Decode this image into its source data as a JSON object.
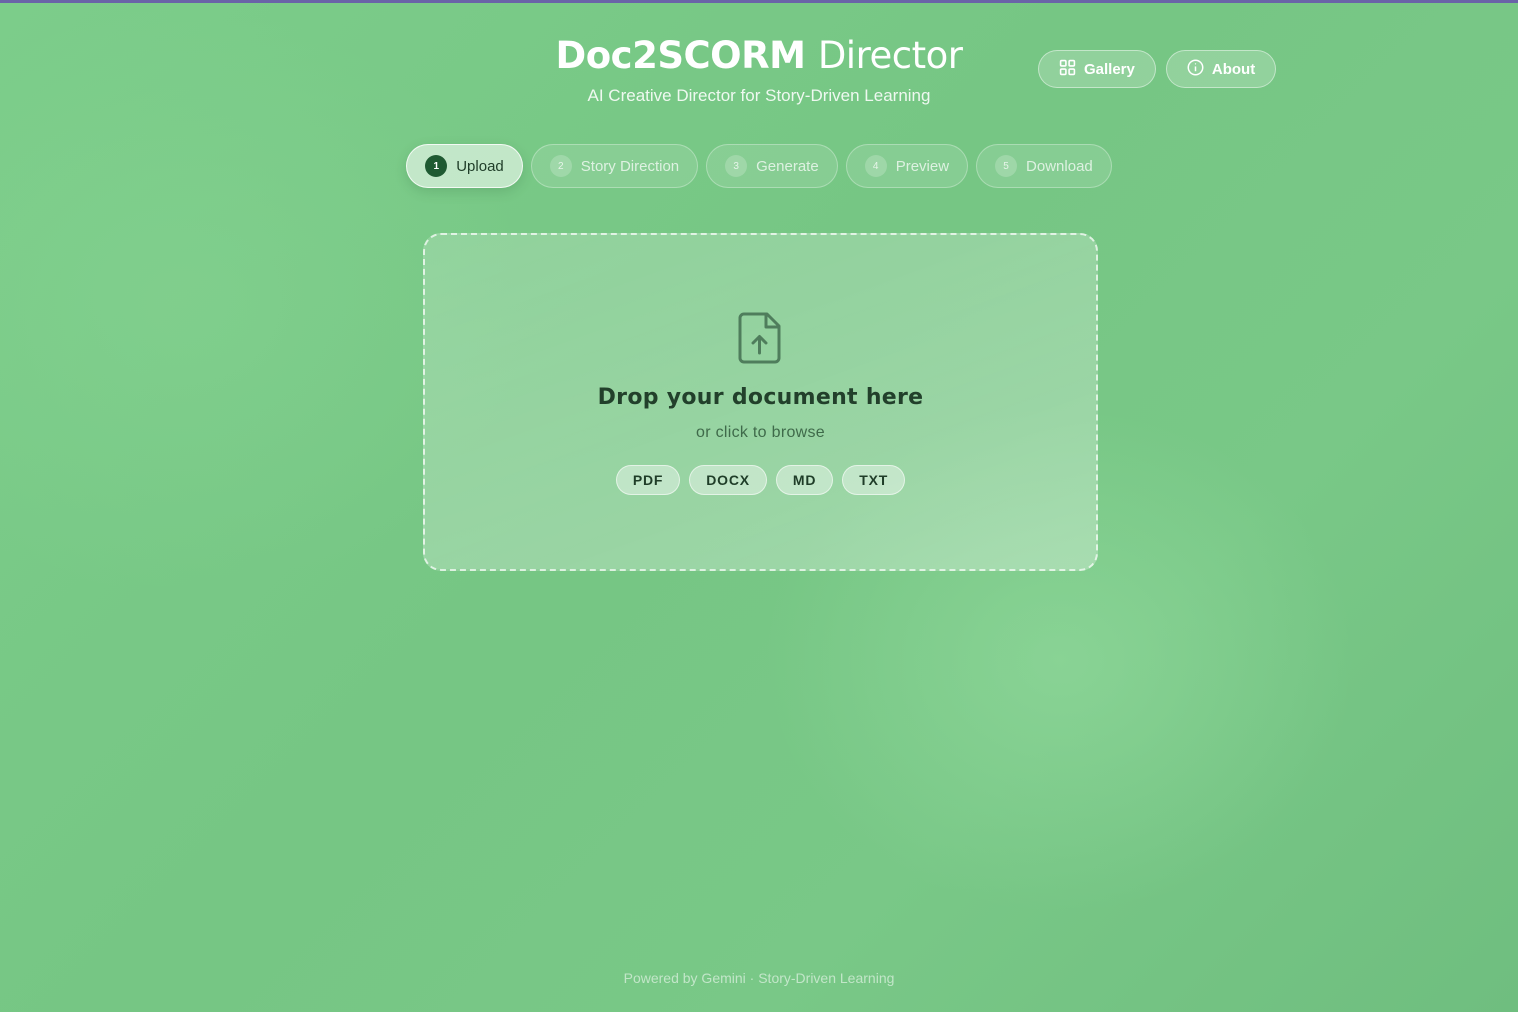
{
  "header": {
    "title_main": "Doc2SCORM",
    "title_sub": "Director",
    "subtitle": "AI Creative Director for Story-Driven Learning"
  },
  "nav": {
    "gallery_label": "Gallery",
    "gallery_icon": "grid-icon",
    "about_label": "About",
    "about_icon": "info-icon"
  },
  "steps": [
    {
      "num": "1",
      "label": "Upload",
      "active": true
    },
    {
      "num": "2",
      "label": "Story Direction",
      "active": false
    },
    {
      "num": "3",
      "label": "Generate",
      "active": false
    },
    {
      "num": "4",
      "label": "Preview",
      "active": false
    },
    {
      "num": "5",
      "label": "Download",
      "active": false
    }
  ],
  "dropzone": {
    "icon": "file-upload-icon",
    "title": "Drop your document here",
    "subtitle": "or click to browse",
    "formats": [
      "PDF",
      "DOCX",
      "MD",
      "TXT"
    ]
  },
  "footer": {
    "text": "Powered by Gemini · Story-Driven Learning"
  },
  "colors": {
    "background": "#77c785",
    "accent_dark": "#1f5a32",
    "top_strip": "#6a63a8"
  }
}
